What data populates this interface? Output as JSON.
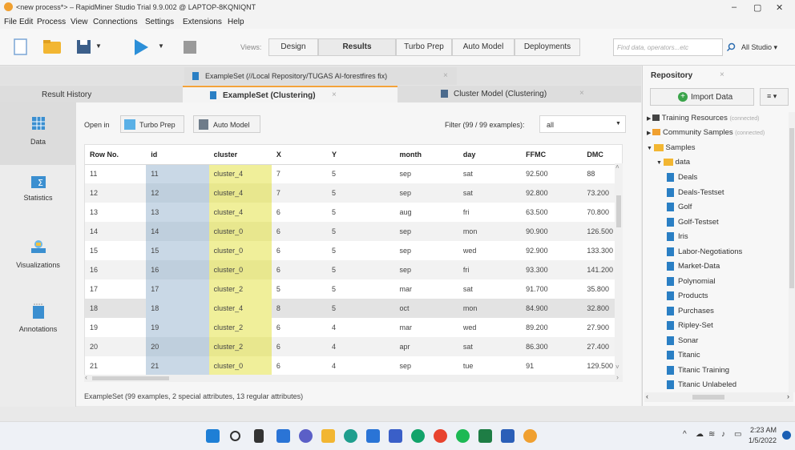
{
  "window": {
    "title": "<new process*> – RapidMiner Studio Trial 9.9.002 @ LAPTOP-8KQNIQNT",
    "minimize": "–",
    "maximize": "▢",
    "close": "✕"
  },
  "menu": [
    "File",
    "Edit",
    "Process",
    "View",
    "Connections",
    "Settings",
    "Extensions",
    "Help"
  ],
  "toolbar": {
    "views_label": "Views:",
    "views": [
      "Design",
      "Results",
      "Turbo Prep",
      "Auto Model",
      "Deployments"
    ],
    "active_view": "Results",
    "search_placeholder": "Find data, operators...etc",
    "studio_label": "All Studio ▾"
  },
  "top_tab": "ExampleSet (//Local Repository/TUGAS AI-forestfires fix)",
  "tabs": {
    "result_history": "Result History",
    "exampleset": "ExampleSet (Clustering)",
    "cluster_model": "Cluster Model (Clustering)"
  },
  "sidebar": [
    "Data",
    "Statistics",
    "Visualizations",
    "Annotations"
  ],
  "open_in": {
    "label": "Open in",
    "turbo_prep": "Turbo Prep",
    "auto_model": "Auto Model"
  },
  "filter": {
    "label": "Filter (99 / 99 examples):",
    "value": "all"
  },
  "table": {
    "columns": [
      "Row No.",
      "id",
      "cluster",
      "X",
      "Y",
      "month",
      "day",
      "FFMC",
      "DMC"
    ],
    "rows": [
      [
        "11",
        "11",
        "cluster_4",
        "7",
        "5",
        "sep",
        "sat",
        "92.500",
        "88"
      ],
      [
        "12",
        "12",
        "cluster_4",
        "7",
        "5",
        "sep",
        "sat",
        "92.800",
        "73.200"
      ],
      [
        "13",
        "13",
        "cluster_4",
        "6",
        "5",
        "aug",
        "fri",
        "63.500",
        "70.800"
      ],
      [
        "14",
        "14",
        "cluster_0",
        "6",
        "5",
        "sep",
        "mon",
        "90.900",
        "126.500"
      ],
      [
        "15",
        "15",
        "cluster_0",
        "6",
        "5",
        "sep",
        "wed",
        "92.900",
        "133.300"
      ],
      [
        "16",
        "16",
        "cluster_0",
        "6",
        "5",
        "sep",
        "fri",
        "93.300",
        "141.200"
      ],
      [
        "17",
        "17",
        "cluster_2",
        "5",
        "5",
        "mar",
        "sat",
        "91.700",
        "35.800"
      ],
      [
        "18",
        "18",
        "cluster_4",
        "8",
        "5",
        "oct",
        "mon",
        "84.900",
        "32.800"
      ],
      [
        "19",
        "19",
        "cluster_2",
        "6",
        "4",
        "mar",
        "wed",
        "89.200",
        "27.900"
      ],
      [
        "20",
        "20",
        "cluster_2",
        "6",
        "4",
        "apr",
        "sat",
        "86.300",
        "27.400"
      ],
      [
        "21",
        "21",
        "cluster_0",
        "6",
        "4",
        "sep",
        "tue",
        "91",
        "129.500"
      ],
      [
        "22",
        "22",
        "cluster_4",
        "5",
        "4",
        "sep",
        "mon",
        "91.800",
        "78.500"
      ]
    ]
  },
  "status": "ExampleSet (99 examples, 2 special attributes, 13 regular attributes)",
  "repository": {
    "title": "Repository",
    "import_button": "Import Data",
    "training": "Training Resources",
    "training_tag": "(connected)",
    "community": "Community Samples",
    "community_tag": "(connected)",
    "samples": "Samples",
    "data_folder": "data",
    "items": [
      "Deals",
      "Deals-Testset",
      "Golf",
      "Golf-Testset",
      "Iris",
      "Labor-Negotiations",
      "Market-Data",
      "Polynomial",
      "Products",
      "Purchases",
      "Ripley-Set",
      "Sonar",
      "Titanic",
      "Titanic Training",
      "Titanic Unlabeled"
    ]
  },
  "clock": {
    "time": "2:23 AM",
    "date": "1/5/2022"
  }
}
